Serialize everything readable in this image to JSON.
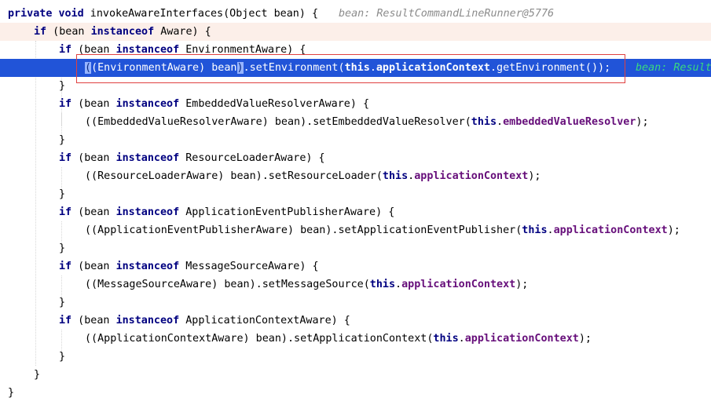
{
  "editor": {
    "lines": [
      {
        "kind": "method",
        "t1": "private",
        "t2": " ",
        "t3": "void",
        "t4": " invokeAwareInterfaces(Object bean) {",
        "hint": "bean: ResultCommandLineRunner@5776"
      },
      {
        "kind": "if-outer",
        "kw": "if",
        "t1": " (bean ",
        "kw2": "instanceof",
        "t2": " Aware) {"
      },
      {
        "kind": "if",
        "kw": "if",
        "t1": " (bean ",
        "kw2": "instanceof",
        "t2": " EnvironmentAware) {"
      },
      {
        "kind": "exec",
        "c1": "(",
        "c2": "(EnvironmentAware) bean",
        "c3": ")",
        "c4": ".setEnvironment(",
        "this": "this",
        "dot": ".",
        "field": "applicationContext",
        "c5": ".getEnvironment());",
        "hint": "bean: Result"
      },
      {
        "kind": "close",
        "text": "}"
      },
      {
        "kind": "if",
        "kw": "if",
        "t1": " (bean ",
        "kw2": "instanceof",
        "t2": " EmbeddedValueResolverAware) {"
      },
      {
        "kind": "call",
        "t1": "((EmbeddedValueResolverAware) bean).setEmbeddedValueResolver(",
        "this": "this",
        "dot": ".",
        "field": "embeddedValueResolver",
        "t2": ");"
      },
      {
        "kind": "close",
        "text": "}"
      },
      {
        "kind": "if",
        "kw": "if",
        "t1": " (bean ",
        "kw2": "instanceof",
        "t2": " ResourceLoaderAware) {"
      },
      {
        "kind": "call",
        "t1": "((ResourceLoaderAware) bean).setResourceLoader(",
        "this": "this",
        "dot": ".",
        "field": "applicationContext",
        "t2": ");"
      },
      {
        "kind": "close",
        "text": "}"
      },
      {
        "kind": "if",
        "kw": "if",
        "t1": " (bean ",
        "kw2": "instanceof",
        "t2": " ApplicationEventPublisherAware) {"
      },
      {
        "kind": "call",
        "t1": "((ApplicationEventPublisherAware) bean).setApplicationEventPublisher(",
        "this": "this",
        "dot": ".",
        "field": "applicationContext",
        "t2": ");"
      },
      {
        "kind": "close",
        "text": "}"
      },
      {
        "kind": "if",
        "kw": "if",
        "t1": " (bean ",
        "kw2": "instanceof",
        "t2": " MessageSourceAware) {"
      },
      {
        "kind": "call",
        "t1": "((MessageSourceAware) bean).setMessageSource(",
        "this": "this",
        "dot": ".",
        "field": "applicationContext",
        "t2": ");"
      },
      {
        "kind": "close",
        "text": "}"
      },
      {
        "kind": "if",
        "kw": "if",
        "t1": " (bean ",
        "kw2": "instanceof",
        "t2": " ApplicationContextAware) {"
      },
      {
        "kind": "call",
        "t1": "((ApplicationContextAware) bean).setApplicationContext(",
        "this": "this",
        "dot": ".",
        "field": "applicationContext",
        "t2": ");"
      },
      {
        "kind": "close",
        "text": "}"
      },
      {
        "kind": "close",
        "text": "}"
      },
      {
        "kind": "close",
        "text": "}"
      }
    ]
  },
  "colors": {
    "keyword": "#000080",
    "field": "#660e7a",
    "debug_hint": "#8c8c8c",
    "execution_line": "#2154d8",
    "scope_highlight": "#fcefe9",
    "selection_box": "#e04040"
  }
}
